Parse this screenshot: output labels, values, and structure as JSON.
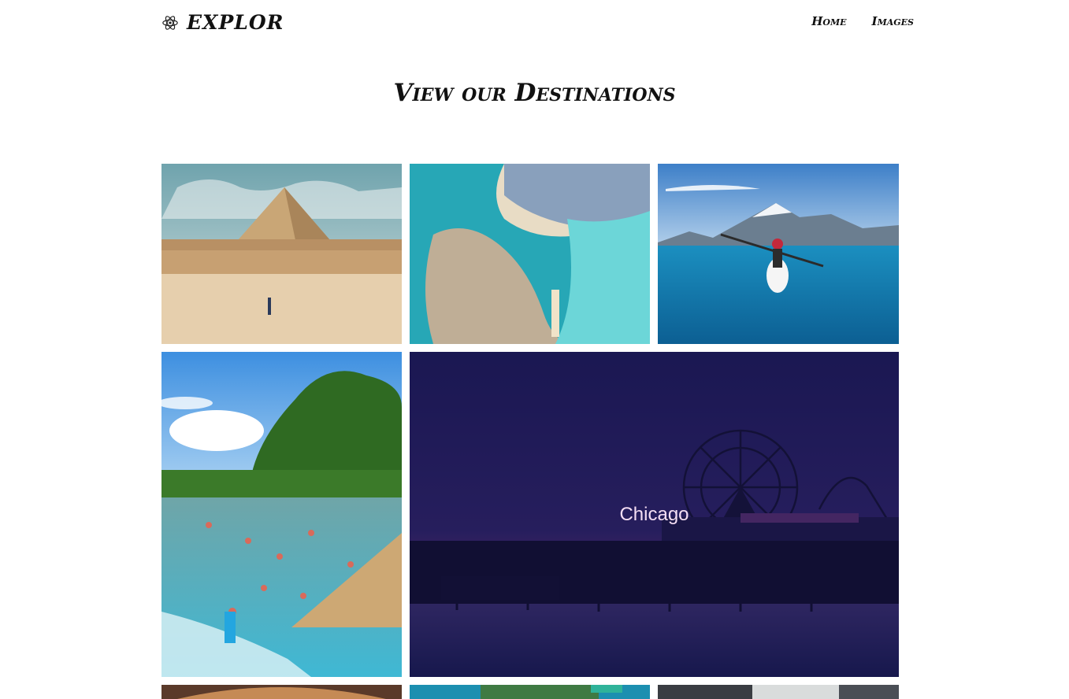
{
  "brand": {
    "name": "EXPLOR",
    "icon": "atom-icon"
  },
  "nav": {
    "home": "Home",
    "images": "Images"
  },
  "page": {
    "title": "View our Destinations"
  },
  "gallery": {
    "hover_caption": "Chicago",
    "tiles": [
      {
        "subject": "pyramid",
        "interactable": true
      },
      {
        "subject": "aerial-beach",
        "interactable": true
      },
      {
        "subject": "kayak-lake",
        "interactable": true
      },
      {
        "subject": "river-swimmers",
        "interactable": true
      },
      {
        "subject": "pier-ferris-wheel-night",
        "interactable": true
      },
      {
        "subject": "building-interior",
        "interactable": true
      },
      {
        "subject": "aerial-coast",
        "interactable": true
      },
      {
        "subject": "city-street",
        "interactable": true
      }
    ]
  },
  "colors": {
    "hover_overlay": "#1d1a52",
    "caption": "#f3ddf3"
  }
}
